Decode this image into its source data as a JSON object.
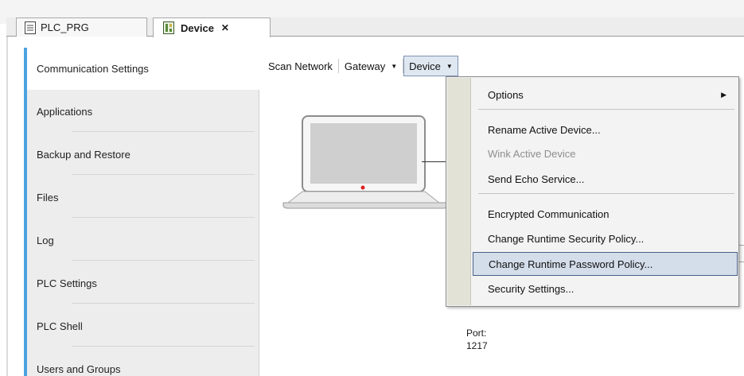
{
  "editor_tabs": [
    {
      "label": "PLC_PRG",
      "icon": "program-document-icon"
    },
    {
      "label": "Device",
      "icon": "device-icon",
      "active": true,
      "close_symbol": "✕"
    }
  ],
  "nav": {
    "items": [
      {
        "label": "Communication Settings",
        "active": true
      },
      {
        "label": "Applications"
      },
      {
        "label": "Backup and Restore"
      },
      {
        "label": "Files"
      },
      {
        "label": "Log"
      },
      {
        "label": "PLC Settings"
      },
      {
        "label": "PLC Shell"
      },
      {
        "label": "Users and Groups"
      }
    ]
  },
  "toolbar": {
    "scan_network": "Scan Network",
    "gateway": "Gateway",
    "device": "Device",
    "caret": "▼"
  },
  "device_menu": {
    "items": [
      {
        "label": "Options",
        "submenu": true
      },
      {
        "label": "Rename Active Device..."
      },
      {
        "label": "Wink Active Device",
        "disabled": true
      },
      {
        "label": "Send Echo Service..."
      },
      {
        "label": "Encrypted Communication"
      },
      {
        "label": "Change Runtime Security Policy..."
      },
      {
        "label": "Change Runtime Password Policy...",
        "highlighted": true
      },
      {
        "label": "Security Settings..."
      }
    ],
    "submenu_arrow": "▶"
  },
  "canvas": {
    "port_label": "Port:",
    "port_value": "1217"
  },
  "colors": {
    "nav_accent": "#4aa3e0",
    "menu_highlight": "#d4ddea",
    "menu_highlight_border": "#4a6188",
    "device_led": "#e02020"
  }
}
